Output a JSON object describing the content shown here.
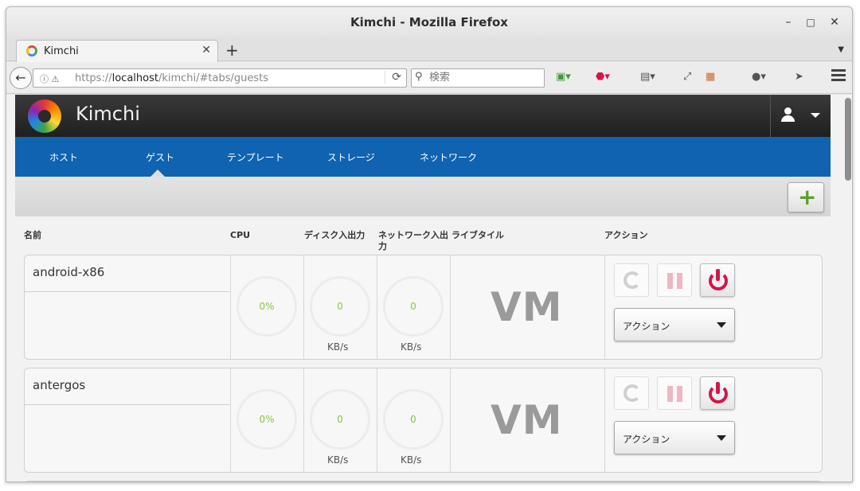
{
  "window": {
    "title": "Kimchi - Mozilla Firefox",
    "minimize": "–",
    "maximize": "□",
    "close": "✕"
  },
  "tab": {
    "label": "Kimchi",
    "close": "✕",
    "new_tab": "+"
  },
  "urlbar": {
    "prefix": "https://",
    "host": "localhost",
    "path": "/kimchi/#tabs/guests"
  },
  "search": {
    "placeholder": "検索"
  },
  "app": {
    "title": "Kimchi",
    "nav": [
      "ホスト",
      "ゲスト",
      "テンプレート",
      "ストレージ",
      "ネットワーク"
    ],
    "active_nav": "ゲスト"
  },
  "toolbar": {
    "add_label": "+"
  },
  "columns": {
    "name": "名前",
    "cpu": "CPU",
    "disk": "ディスク入出力",
    "network_l1": "ネットワーク入出",
    "network_l2": "力",
    "livetile": "ライブタイル",
    "actions": "アクション"
  },
  "guests": [
    {
      "name": "android-x86",
      "cpu": "0%",
      "disk": "0",
      "disk_unit": "KB/s",
      "net": "0",
      "net_unit": "KB/s",
      "tile": "VM",
      "action_select": "アクション"
    },
    {
      "name": "antergos",
      "cpu": "0%",
      "disk": "0",
      "disk_unit": "KB/s",
      "net": "0",
      "net_unit": "KB/s",
      "tile": "VM",
      "action_select": "アクション"
    }
  ],
  "colors": {
    "nav_blue": "#0f63b0",
    "power_red": "#d6144a",
    "gauge_green": "#8cc63f",
    "add_green": "#5aa02c"
  }
}
